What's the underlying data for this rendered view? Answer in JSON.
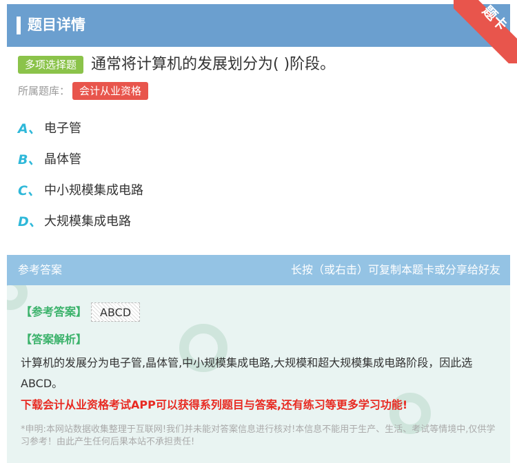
{
  "header": {
    "title": "题目详情"
  },
  "ribbon": {
    "label": "题卡"
  },
  "question": {
    "type_tag": "多项选择题",
    "text": "通常将计算机的发展划分为( )阶段。",
    "bank_label": "所属题库：",
    "bank_name": "会计从业资格"
  },
  "options": [
    {
      "letter": "A、",
      "text": "电子管"
    },
    {
      "letter": "B、",
      "text": "晶体管"
    },
    {
      "letter": "C、",
      "text": "中小规模集成电路"
    },
    {
      "letter": "D、",
      "text": "大规模集成电路"
    }
  ],
  "answer": {
    "header_left": "参考答案",
    "header_right": "长按（或右击）可复制本题卡或分享给好友",
    "ref_label": "【参考答案】",
    "ref_value": "ABCD",
    "analysis_label": "【答案解析】",
    "analysis_text": "计算机的发展分为电子管,晶体管,中小规模集成电路,大规模和超大规模集成电路阶段，因此选ABCD。",
    "promo": "下载会计从业资格考试APP可以获得系列题目与答案,还有练习等更多学习功能!",
    "disclaimer": "*申明:本网站数据收集整理于互联网!我们并未能对答案信息进行核对!本信息不能用于生产、生活、考试等情境中,仅供学习参考！由此产生任何后果本站不承担责任!"
  },
  "colors": {
    "header": "#6b9fcf",
    "accent": "#2fb8d9",
    "tag_green": "#8bc34a",
    "tag_red": "#e8554c"
  }
}
